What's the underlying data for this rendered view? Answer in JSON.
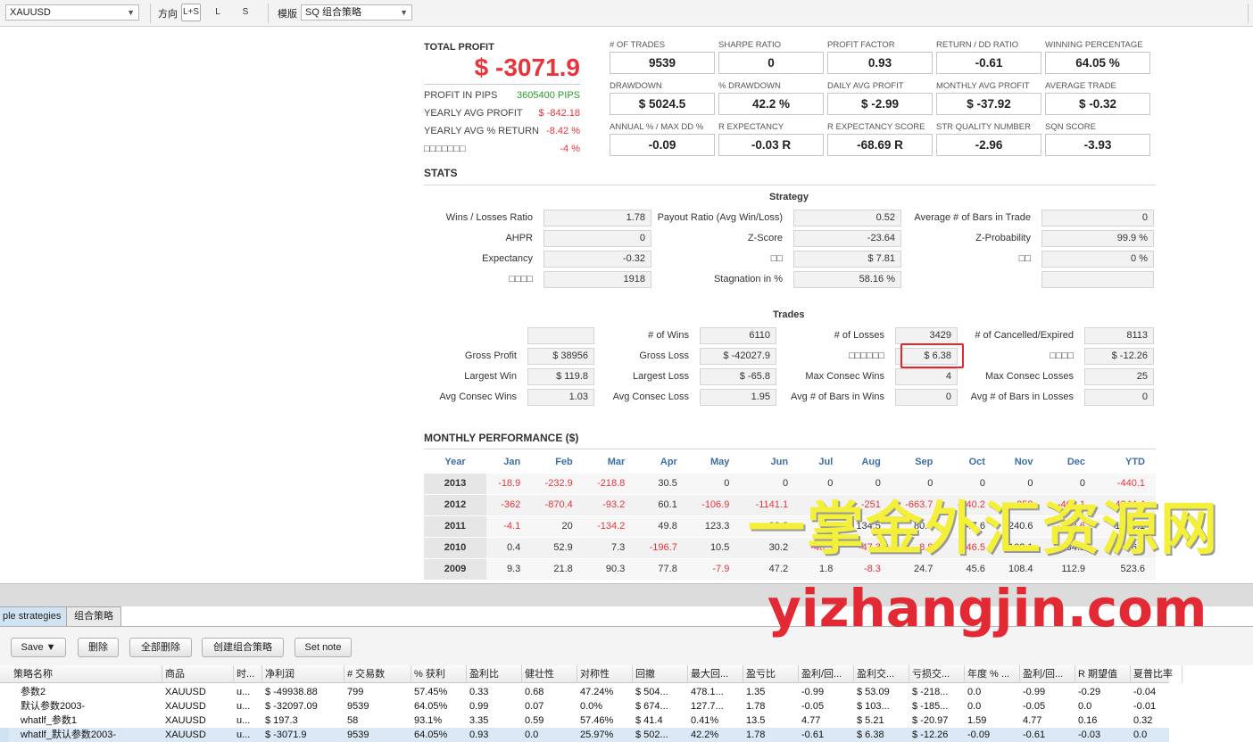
{
  "toolbar": {
    "symbol": "XAUUSD",
    "direction_label": "方向",
    "directions": [
      "L+S",
      "L",
      "S"
    ],
    "template_label": "模版",
    "template_value": "SQ 组合策略"
  },
  "summary": {
    "total_profit_label": "TOTAL PROFIT",
    "total_profit_value": "$ -3071.9",
    "rows": [
      {
        "label": "PROFIT IN PIPS",
        "value": "3605400 PIPS",
        "color": "#2a9b2a"
      },
      {
        "label": "YEARLY AVG PROFIT",
        "value": "$ -842.18",
        "color": "#e8343b"
      },
      {
        "label": "YEARLY AVG % RETURN",
        "value": "-8.42 %",
        "color": "#e8343b"
      },
      {
        "label": "□□□□□□□",
        "value": "-4 %",
        "color": "#e8343b"
      }
    ]
  },
  "metrics": [
    {
      "label": "# OF TRADES",
      "value": "9539"
    },
    {
      "label": "SHARPE RATIO",
      "value": "0"
    },
    {
      "label": "PROFIT FACTOR",
      "value": "0.93"
    },
    {
      "label": "RETURN / DD RATIO",
      "value": "-0.61"
    },
    {
      "label": "WINNING PERCENTAGE",
      "value": "64.05 %"
    },
    {
      "label": "DRAWDOWN",
      "value": "$ 5024.5"
    },
    {
      "label": "% DRAWDOWN",
      "value": "42.2 %"
    },
    {
      "label": "DAILY AVG PROFIT",
      "value": "$ -2.99"
    },
    {
      "label": "MONTHLY AVG PROFIT",
      "value": "$ -37.92"
    },
    {
      "label": "AVERAGE TRADE",
      "value": "$ -0.32"
    },
    {
      "label": "ANNUAL % / MAX DD %",
      "value": "-0.09"
    },
    {
      "label": "R EXPECTANCY",
      "value": "-0.03 R"
    },
    {
      "label": "R EXPECTANCY SCORE",
      "value": "-68.69 R"
    },
    {
      "label": "STR QUALITY NUMBER",
      "value": "-2.96"
    },
    {
      "label": "SQN SCORE",
      "value": "-3.93"
    }
  ],
  "stats": {
    "title": "STATS",
    "strategy_title": "Strategy",
    "strategy": [
      [
        {
          "label": "Wins / Losses Ratio",
          "value": "1.78"
        },
        {
          "label": "Payout Ratio (Avg Win/Loss)",
          "value": "0.52"
        },
        {
          "label": "Average # of Bars in Trade",
          "value": "0"
        }
      ],
      [
        {
          "label": "AHPR",
          "value": "0"
        },
        {
          "label": "Z-Score",
          "value": "-23.64"
        },
        {
          "label": "Z-Probability",
          "value": "99.9 %"
        }
      ],
      [
        {
          "label": "Expectancy",
          "value": "-0.32"
        },
        {
          "label": "□□",
          "value": "$ 7.81"
        },
        {
          "label": "□□",
          "value": "0 %"
        }
      ],
      [
        {
          "label": "□□□□",
          "value": "1918"
        },
        {
          "label": "Stagnation in %",
          "value": "58.16 %"
        },
        {
          "label": "",
          "value": ""
        }
      ]
    ],
    "trades_title": "Trades",
    "trades": [
      [
        {
          "label": "",
          "value": ""
        },
        {
          "label": "# of Wins",
          "value": "6110"
        },
        {
          "label": "# of Losses",
          "value": "3429"
        },
        {
          "label": "# of Cancelled/Expired",
          "value": "8113"
        }
      ],
      [
        {
          "label": "Gross Profit",
          "value": "$ 38956"
        },
        {
          "label": "Gross Loss",
          "value": "$ -42027.9"
        },
        {
          "label": "□□□□□□",
          "value": "$ 6.38"
        },
        {
          "label": "□□□□",
          "value": "$ -12.26"
        }
      ],
      [
        {
          "label": "Largest Win",
          "value": "$ 119.8"
        },
        {
          "label": "Largest Loss",
          "value": "$ -65.8"
        },
        {
          "label": "Max Consec Wins",
          "value": "4"
        },
        {
          "label": "Max Consec Losses",
          "value": "25"
        }
      ],
      [
        {
          "label": "Avg Consec Wins",
          "value": "1.03"
        },
        {
          "label": "Avg Consec Loss",
          "value": "1.95"
        },
        {
          "label": "Avg # of Bars in Wins",
          "value": "0"
        },
        {
          "label": "Avg # of Bars in Losses",
          "value": "0"
        }
      ]
    ]
  },
  "monthly": {
    "title": "MONTHLY PERFORMANCE ($)",
    "headers": [
      "Year",
      "Jan",
      "Feb",
      "Mar",
      "Apr",
      "May",
      "Jun",
      "Jul",
      "Aug",
      "Sep",
      "Oct",
      "Nov",
      "Dec",
      "YTD"
    ],
    "rows": [
      [
        "2013",
        "-18.9",
        "-232.9",
        "-218.8",
        "30.5",
        "0",
        "0",
        "0",
        "0",
        "0",
        "0",
        "0",
        "0",
        "-440.1"
      ],
      [
        "2012",
        "-362",
        "-870.4",
        "-93.2",
        "60.1",
        "-106.9",
        "-1141.1",
        "",
        "-251",
        "-663.7",
        "-140.2",
        "-258",
        "-463.1",
        "-4344.4"
      ],
      [
        "2011",
        "-4.1",
        "20",
        "-134.2",
        "49.8",
        "123.3",
        "93.3",
        "",
        "134.5",
        "80.4",
        "147.6",
        "240.6",
        "-172.6",
        "1909.1"
      ],
      [
        "2010",
        "0.4",
        "52.9",
        "7.3",
        "-196.7",
        "10.5",
        "30.2",
        "-40.5",
        "-47.3",
        "-8.8",
        "-46.5",
        "102.1",
        "164.1",
        "26.7"
      ],
      [
        "2009",
        "9.3",
        "21.8",
        "90.3",
        "77.8",
        "-7.9",
        "47.2",
        "1.8",
        "-8.3",
        "24.7",
        "45.6",
        "108.4",
        "112.9",
        "523.6"
      ]
    ]
  },
  "bottom": {
    "tabs": [
      "ple strategies",
      "组合策略"
    ],
    "buttons": [
      "Save ▼",
      "删除",
      "全部删除",
      "创建组合策略",
      "Set note"
    ],
    "columns": [
      "策略名称",
      "商品",
      "时...",
      "净利润",
      "# 交易数",
      "% 获利",
      "盈利比",
      "健壮性",
      "对称性",
      "回撤",
      "最大回...",
      "盈亏比",
      "盈利/回...",
      "盈利交...",
      "亏损交...",
      "年度 % ...",
      "盈利/回...",
      "R 期望值",
      "夏普比率"
    ],
    "rows": [
      [
        "参数2",
        "XAUUSD",
        "u...",
        "$ -49938.88",
        "799",
        "57.45%",
        "0.33",
        "0.68",
        "47.24%",
        "$ 504...",
        "478.1...",
        "1.35",
        "-0.99",
        "$ 53.09",
        "$ -218...",
        "0.0",
        "-0.99",
        "-0.29",
        "-0.04"
      ],
      [
        "默认参数2003-",
        "XAUUSD",
        "u...",
        "$ -32097.09",
        "9539",
        "64.05%",
        "0.99",
        "0.07",
        "0.0%",
        "$ 674...",
        "127.7...",
        "1.78",
        "-0.05",
        "$ 103...",
        "$ -185...",
        "0.0",
        "-0.05",
        "0.0",
        "-0.01"
      ],
      [
        "whatlf_参数1",
        "XAUUSD",
        "u...",
        "$ 197.3",
        "58",
        "93.1%",
        "3.35",
        "0.59",
        "57.46%",
        "$ 41.4",
        "0.41%",
        "13.5",
        "4.77",
        "$ 5.21",
        "$ -20.97",
        "1.59",
        "4.77",
        "0.16",
        "0.32"
      ],
      [
        "whatlf_默认参数2003-",
        "XAUUSD",
        "u...",
        "$ -3071.9",
        "9539",
        "64.05%",
        "0.93",
        "0.0",
        "25.97%",
        "$ 502...",
        "42.2%",
        "1.78",
        "-0.61",
        "$ 6.38",
        "$ -12.26",
        "-0.09",
        "-0.61",
        "-0.03",
        "0.0"
      ]
    ]
  },
  "watermark": {
    "line1": "一掌金外汇资源网",
    "line2": "yizhangjin.com"
  }
}
